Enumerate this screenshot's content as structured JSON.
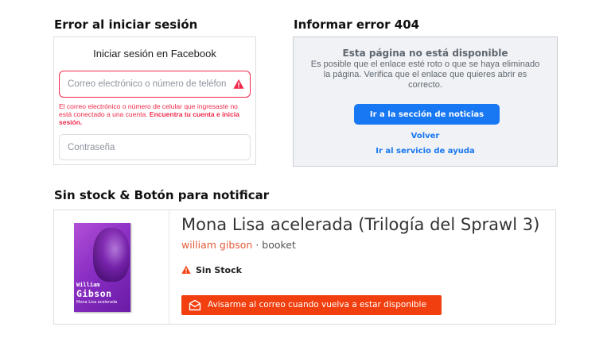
{
  "sections": {
    "login_error_title": "Error al iniciar sesión",
    "report_404_title": "Informar error 404",
    "out_of_stock_title": "Sin stock & Botón para notificar"
  },
  "login": {
    "heading": "Iniciar sesión en Facebook",
    "email_placeholder": "Correo electrónico o número de teléfono",
    "error_text": "El correo electrónico o número de celular que ingresaste no está conectado a una cuenta.",
    "error_link": "Encuentra tu cuenta e inicia sesión.",
    "password_placeholder": "Contraseña",
    "error_color": "#f02849"
  },
  "not_found": {
    "heading": "Esta página no está disponible",
    "description": "Es posible que el enlace esté roto o que se haya eliminado la página. Verifica que el enlace que quieres abrir es correcto.",
    "news_button": "Ir a la sección de noticias",
    "back_link": "Volver",
    "help_link": "Ir al servicio de ayuda",
    "accent_color": "#1877f2"
  },
  "product": {
    "title": "Mona Lisa acelerada (Trilogía del Sprawl 3)",
    "author": "william gibson",
    "separator": " · ",
    "publisher": "booket",
    "stock_status": "Sin Stock",
    "notify_button": "Avisarme al correo cuando vuelva a estar disponible",
    "cover": {
      "author_line_1": "William",
      "author_line_2": "Gibson",
      "subtitle": "Mona Lisa acelerada"
    },
    "accent_color": "#f23f0f",
    "icons": {
      "stock": "warning-icon",
      "notify": "mail-icon"
    }
  }
}
